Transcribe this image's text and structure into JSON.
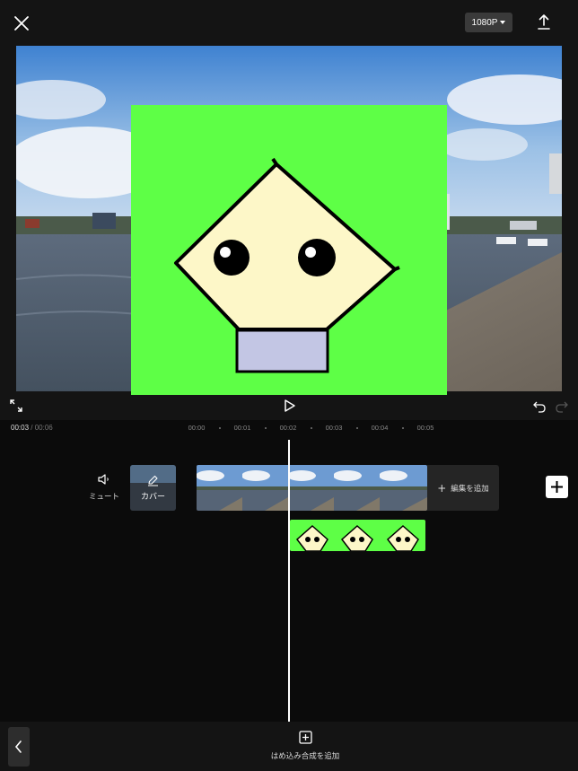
{
  "topbar": {
    "resolution": "1080P"
  },
  "timeline": {
    "current_time": "00:03",
    "separator": "/",
    "total_time": "00:06",
    "ruler_ticks": [
      "00:00",
      "00:01",
      "00:02",
      "00:03",
      "00:04",
      "00:05"
    ]
  },
  "tracks": {
    "mute_label": "ミュート",
    "cover_label": "カバー",
    "add_edit_label": "編集を追加"
  },
  "bottombar": {
    "add_overlay_label": "はめ込み合成を追加"
  },
  "colors": {
    "overlay_green": "#5eff46",
    "face": "#fdf7c8",
    "body": "#c3c6e4"
  }
}
